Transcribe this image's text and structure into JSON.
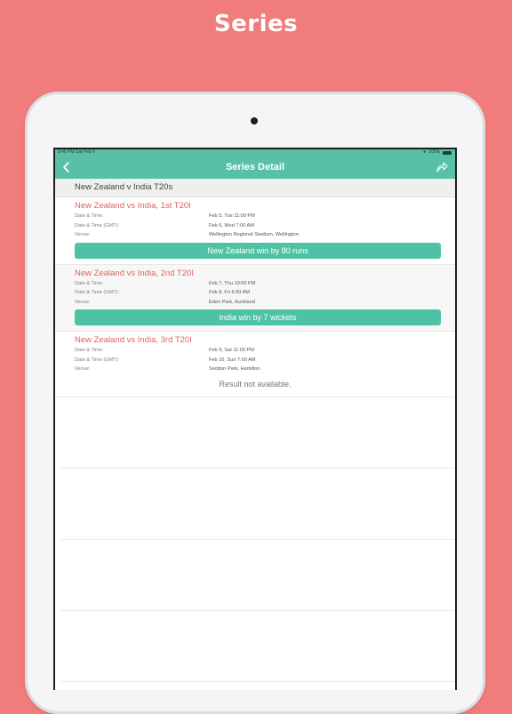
{
  "promo": {
    "title": "Series"
  },
  "status_bar": {
    "time": "8:46 PM  Sat Feb 9",
    "battery": "100%"
  },
  "nav": {
    "title": "Series Detail"
  },
  "series": {
    "name": "New Zealand v India T20s"
  },
  "labels": {
    "date_time": "Date & Time:",
    "date_time_gmt": "Date & Time (GMT):",
    "venue": "Venue:"
  },
  "matches": [
    {
      "title": "New Zealand vs India, 1st T20I",
      "date_time": "Feb 5, Tue 11:00 PM",
      "date_time_gmt": "Feb 6, Wed 7:00 AM",
      "venue": "Wellington Regional Stadium, Wellington",
      "result": "New Zealand win by 80 runs"
    },
    {
      "title": "New Zealand vs India, 2nd T20I",
      "date_time": "Feb 7, Thu 10:00 PM",
      "date_time_gmt": "Feb 8, Fri 6:00 AM",
      "venue": "Eden Park, Auckland",
      "result": "India win by 7 wickets"
    },
    {
      "title": "New Zealand vs India, 3rd T20I",
      "date_time": "Feb 9, Sat 11:00 PM",
      "date_time_gmt": "Feb 10, Sun 7:00 AM",
      "venue": "Seddon Park, Hamilton",
      "result": "Result not available."
    }
  ],
  "icons": {
    "back": "chevron-left-icon",
    "share": "share-icon"
  },
  "colors": {
    "background": "#f07c7b",
    "accent": "#57c0a7",
    "match_title": "#e0625f",
    "result": "#4fc2a5"
  }
}
